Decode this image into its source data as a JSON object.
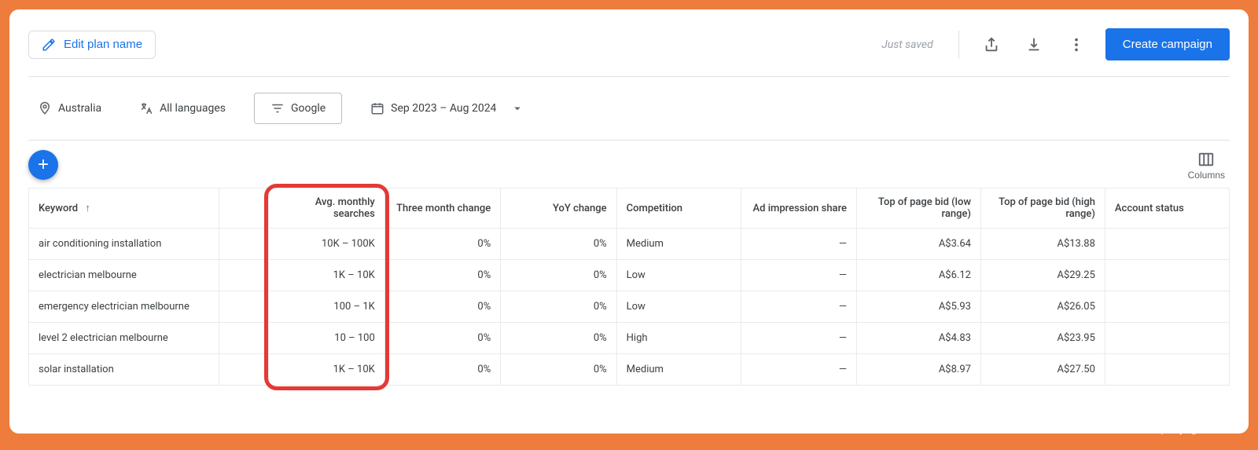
{
  "header": {
    "edit_plan_label": "Edit plan name",
    "just_saved": "Just saved",
    "create_campaign_label": "Create campaign"
  },
  "filters": {
    "location": "Australia",
    "language": "All languages",
    "network": "Google",
    "date_range": "Sep 2023 – Aug 2024"
  },
  "columns_label": "Columns",
  "table": {
    "headers": {
      "keyword": "Keyword",
      "avg_monthly": "Avg. monthly searches",
      "three_month": "Three month change",
      "yoy": "YoY change",
      "competition": "Competition",
      "ad_impression": "Ad impression share",
      "bid_low": "Top of page bid (low range)",
      "bid_high": "Top of page bid (high range)",
      "account_status": "Account status"
    },
    "rows": [
      {
        "keyword": "air conditioning installation",
        "avg": "10K – 100K",
        "three": "0%",
        "yoy": "0%",
        "comp": "Medium",
        "imp": "—",
        "low": "A$3.64",
        "high": "A$13.88",
        "status": ""
      },
      {
        "keyword": "electrician melbourne",
        "avg": "1K – 10K",
        "three": "0%",
        "yoy": "0%",
        "comp": "Low",
        "imp": "—",
        "low": "A$6.12",
        "high": "A$29.25",
        "status": ""
      },
      {
        "keyword": "emergency electrician melbourne",
        "avg": "100 – 1K",
        "three": "0%",
        "yoy": "0%",
        "comp": "Low",
        "imp": "—",
        "low": "A$5.93",
        "high": "A$26.05",
        "status": ""
      },
      {
        "keyword": "level 2 electrician melbourne",
        "avg": "10 – 100",
        "three": "0%",
        "yoy": "0%",
        "comp": "High",
        "imp": "—",
        "low": "A$4.83",
        "high": "A$23.95",
        "status": ""
      },
      {
        "keyword": "solar installation",
        "avg": "1K – 10K",
        "three": "0%",
        "yoy": "0%",
        "comp": "Medium",
        "imp": "—",
        "low": "A$8.97",
        "high": "A$27.50",
        "status": ""
      }
    ]
  },
  "watermark": "sparkydigital.com.au"
}
